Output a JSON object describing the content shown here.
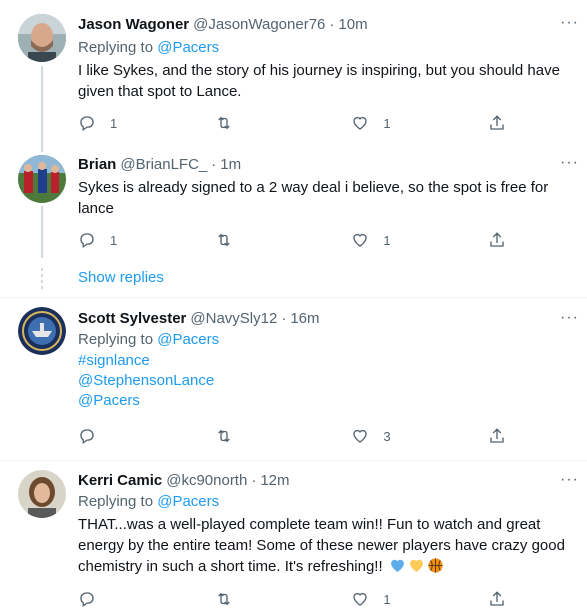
{
  "tweets": [
    {
      "name": "Jason Wagoner",
      "handle": "@JasonWagoner76",
      "time": "10m",
      "replying_prefix": "Replying to ",
      "replying_to": "@Pacers",
      "text": "I like Sykes, and the story of his journey is inspiring, but you should have given that spot to Lance.",
      "replies": "1",
      "retweets": "",
      "likes": "1"
    },
    {
      "name": "Brian",
      "handle": "@BrianLFC_",
      "time": "1m",
      "text": "Sykes is already signed to a 2 way deal i believe, so the spot is free for lance",
      "replies": "1",
      "retweets": "",
      "likes": "1"
    },
    {
      "name": "Scott Sylvester",
      "handle": "@NavySly12",
      "time": "16m",
      "replying_prefix": "Replying to ",
      "replying_to": "@Pacers",
      "links": [
        "#signlance",
        "@StephensonLance",
        "@Pacers"
      ],
      "replies": "",
      "retweets": "",
      "likes": "3"
    },
    {
      "name": "Kerri Camic",
      "handle": "@kc90north",
      "time": "12m",
      "replying_prefix": "Replying to ",
      "replying_to": "@Pacers",
      "text": "THAT...was a well-played complete team win!! Fun to watch and great energy by the entire team! Some of these newer players have crazy good chemistry in such a short time. It's refreshing!!",
      "emojis": [
        "blue-heart",
        "yellow-heart",
        "basketball"
      ],
      "replies": "",
      "retweets": "",
      "likes": "1"
    }
  ],
  "show_replies": "Show replies",
  "separator": "·",
  "more": "···",
  "colors": {
    "link": "#1d9bf0",
    "muted": "#536471",
    "text": "#0f1419"
  }
}
